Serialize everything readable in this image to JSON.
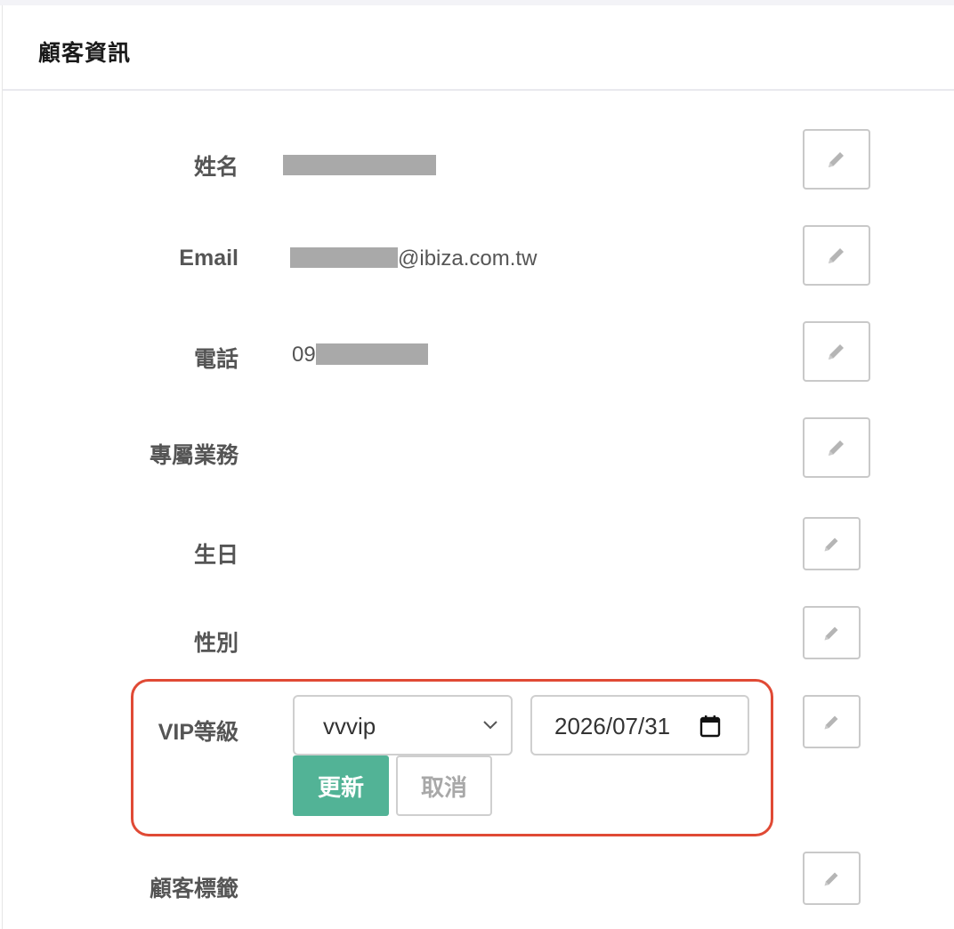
{
  "panel": {
    "title": "顧客資訊"
  },
  "fields": {
    "name": {
      "label": "姓名",
      "value": ""
    },
    "email": {
      "label": "Email",
      "value_suffix": "@ibiza.com.tw"
    },
    "phone": {
      "label": "電話",
      "value_prefix": "09"
    },
    "sales_rep": {
      "label": "專屬業務",
      "value": ""
    },
    "birthday": {
      "label": "生日",
      "value": ""
    },
    "gender": {
      "label": "性別",
      "value": ""
    },
    "vip": {
      "label": "VIP等級",
      "selected_level": "vvvip",
      "date": "2026/07/31",
      "update_label": "更新",
      "cancel_label": "取消"
    },
    "tags": {
      "label": "顧客標籤",
      "value": ""
    }
  },
  "icons": {
    "edit": "pencil-icon",
    "dropdown": "chevron-down-icon",
    "date": "calendar-icon"
  },
  "colors": {
    "update_button": "#52b396",
    "highlight_border": "#e04a35"
  }
}
